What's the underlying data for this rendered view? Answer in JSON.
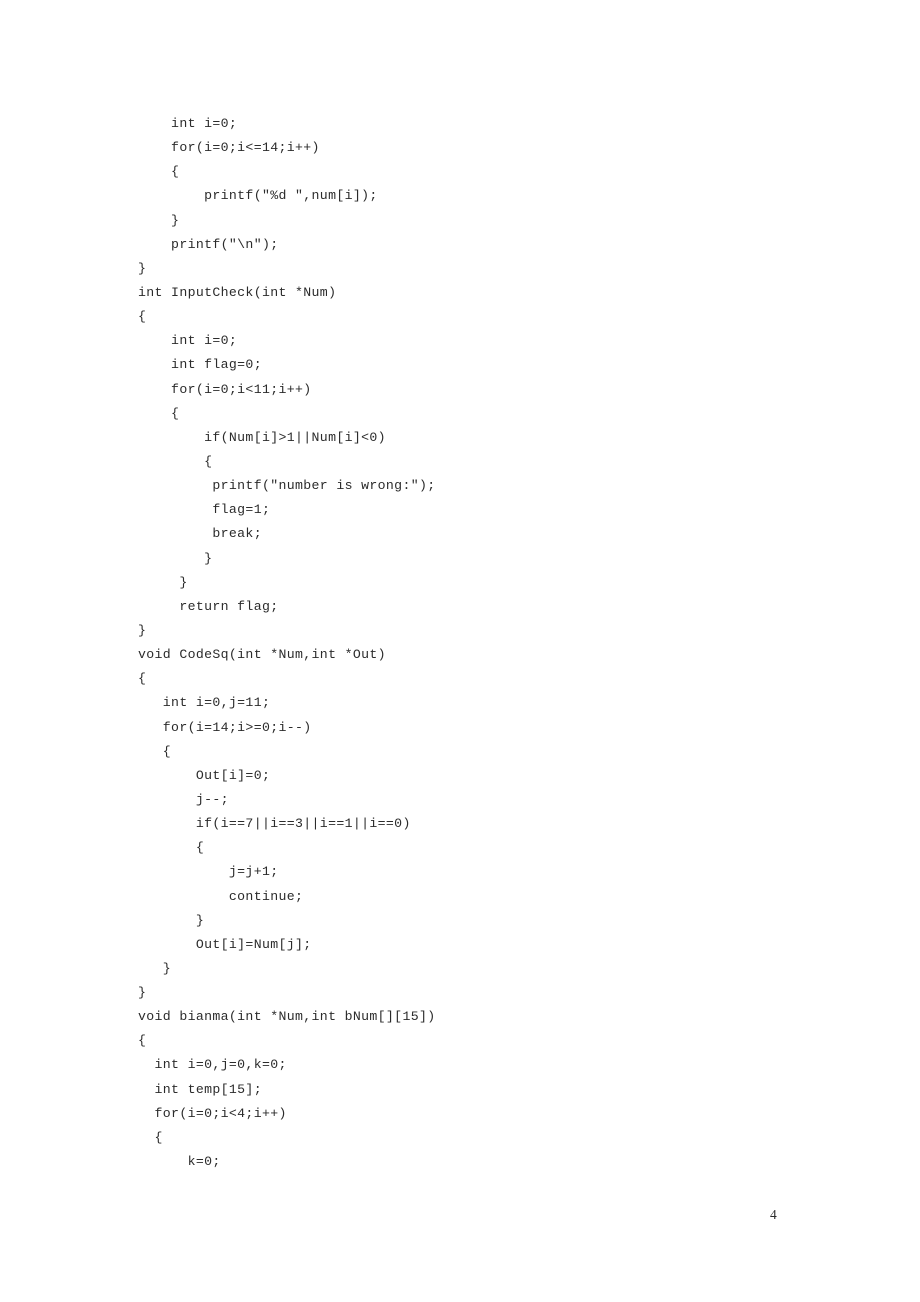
{
  "document": {
    "page_number": "4",
    "language": "c",
    "background_color": "#ffffff",
    "text_color": "#2b2b2b"
  },
  "code": {
    "lines": [
      "    int i=0;",
      "    for(i=0;i<=14;i++)",
      "    {",
      "        printf(\"%d \",num[i]);",
      "    }",
      "    printf(\"\\n\");",
      "}",
      "int InputCheck(int *Num)",
      "{",
      "    int i=0;",
      "    int flag=0;",
      "    for(i=0;i<11;i++)",
      "    {",
      "        if(Num[i]>1||Num[i]<0)",
      "        {",
      "         printf(\"number is wrong:\");",
      "         flag=1;",
      "         break;",
      "        }",
      "     }",
      "     return flag;",
      "}",
      "void CodeSq(int *Num,int *Out)",
      "{",
      "   int i=0,j=11;",
      "   for(i=14;i>=0;i--)",
      "   {",
      "       Out[i]=0;",
      "       j--;",
      "       if(i==7||i==3||i==1||i==0)",
      "       {",
      "           j=j+1;",
      "           continue;",
      "       }",
      "       Out[i]=Num[j];",
      "   }",
      "}",
      "void bianma(int *Num,int bNum[][15])",
      "{",
      "  int i=0,j=0,k=0;",
      "  int temp[15];",
      "  for(i=0;i<4;i++)",
      "  {",
      "      k=0;"
    ]
  }
}
